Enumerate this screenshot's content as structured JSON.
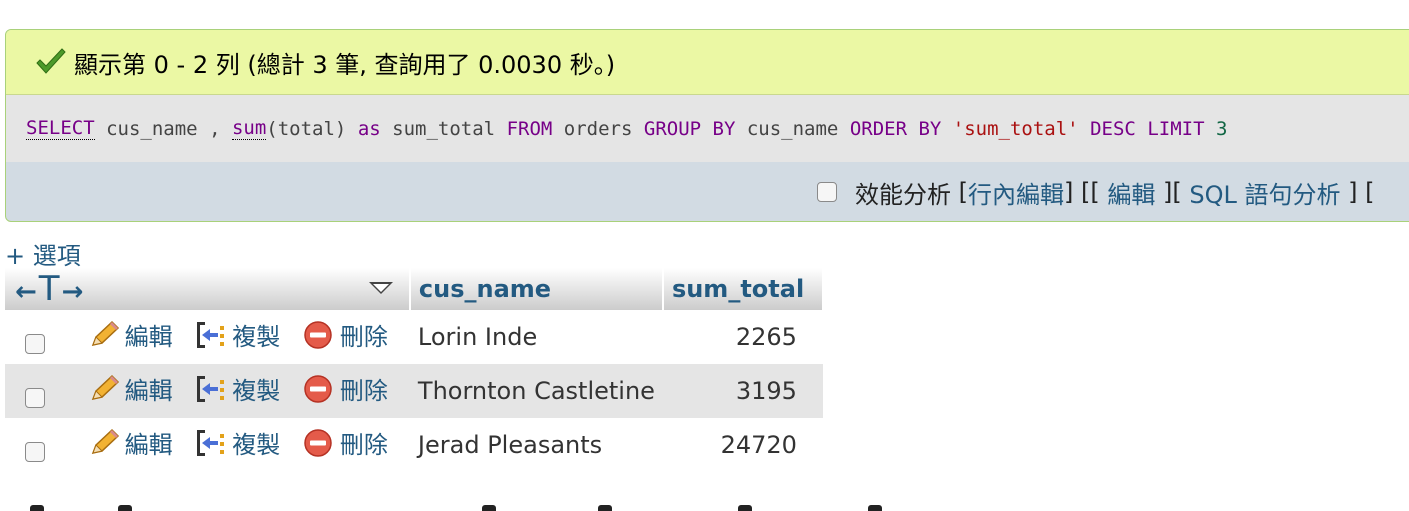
{
  "message": {
    "text": "顯示第 0 - 2 列 (總計 3 筆, 查詢用了 0.0030 秒。)"
  },
  "query": {
    "select": "SELECT",
    "col1": "cus_name",
    "comma": ",",
    "sum_fn": "sum",
    "sum_arg": "(total)",
    "as": "as",
    "alias": "sum_total",
    "from": "FROM",
    "table": "orders",
    "group_by": "GROUP BY",
    "group_col": "cus_name",
    "order_by": "ORDER BY",
    "order_val": "'sum_total'",
    "desc": "DESC",
    "limit": "LIMIT",
    "limit_val": "3"
  },
  "links": {
    "profiling": "效能分析",
    "inline_edit": "行內編輯",
    "edit": "編輯",
    "sql_explain": "SQL 語句分析",
    "bracket_open": "[",
    "bracket_close": "]",
    "bracket_sep": "] [",
    "open_space": "[ ",
    "close_space": " ]",
    "tail": " ] [ "
  },
  "options_label": "+ 選項",
  "table": {
    "col_arrow_left": "←",
    "col_arrow_t": "T",
    "col_arrow_right": "→",
    "columns": [
      "cus_name",
      "sum_total"
    ],
    "action_labels": {
      "edit": "編輯",
      "copy": "複製",
      "delete": "刪除"
    },
    "rows": [
      {
        "cus_name": "Lorin Inde",
        "sum_total": "2265"
      },
      {
        "cus_name": "Thornton Castletine",
        "sum_total": "3195"
      },
      {
        "cus_name": "Jerad Pleasants",
        "sum_total": "24720"
      }
    ]
  },
  "colors": {
    "success_bg": "#ebf8a4",
    "link": "#235a81",
    "sql_keyword": "#770088",
    "sql_string": "#aa1111",
    "sql_number": "#116644"
  }
}
